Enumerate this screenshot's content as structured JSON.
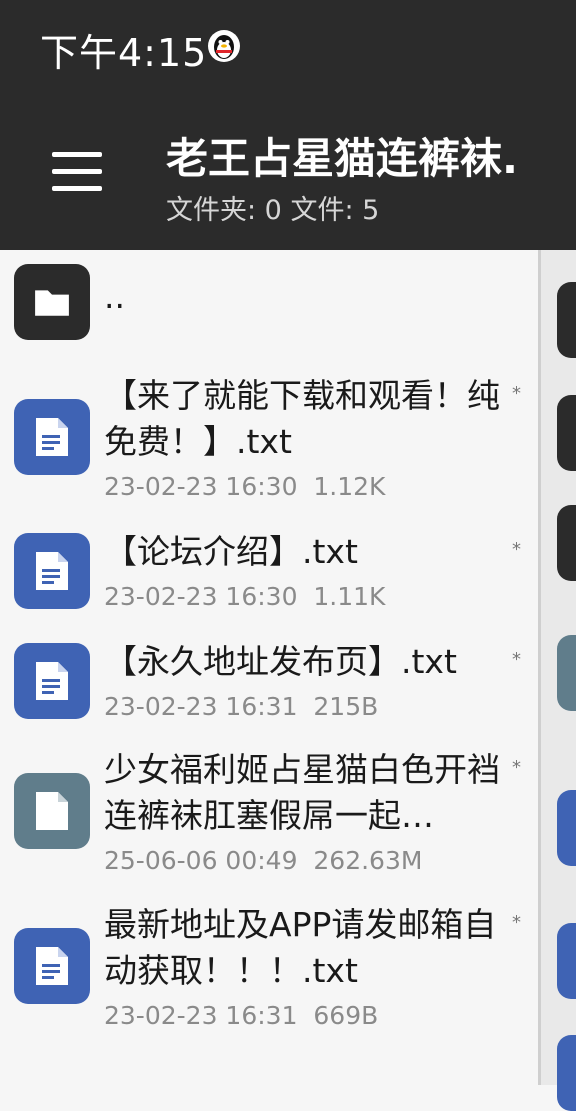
{
  "status_bar": {
    "time": "下午4:15"
  },
  "header": {
    "title": "老王占星猫连裤袜.",
    "subtitle": "文件夹: 0  文件: 5"
  },
  "parent_item": {
    "label": ".."
  },
  "files": [
    {
      "name": "【来了就能下载和观看！纯免费！】.txt",
      "date": "23-02-23 16:30",
      "size": "1.12K",
      "mark": "*"
    },
    {
      "name": "【论坛介绍】.txt",
      "date": "23-02-23 16:30",
      "size": "1.11K",
      "mark": "*"
    },
    {
      "name": "【永久地址发布页】.txt",
      "date": "23-02-23 16:31",
      "size": "215B",
      "mark": "*"
    },
    {
      "name": "少女福利姬占星猫白色开裆连裤袜肛塞假屌一起…",
      "date": "25-06-06 00:49",
      "size": "262.63M",
      "mark": "*"
    },
    {
      "name": "最新地址及APP请发邮箱自动获取！！！.txt",
      "date": "23-02-23 16:31",
      "size": "669B",
      "mark": "*"
    }
  ],
  "colors": {
    "bar": "#2b2b2b",
    "text_file_icon": "#3f63b4",
    "generic_file_icon": "#607d8b",
    "folder_icon": "#2b2b2b"
  }
}
